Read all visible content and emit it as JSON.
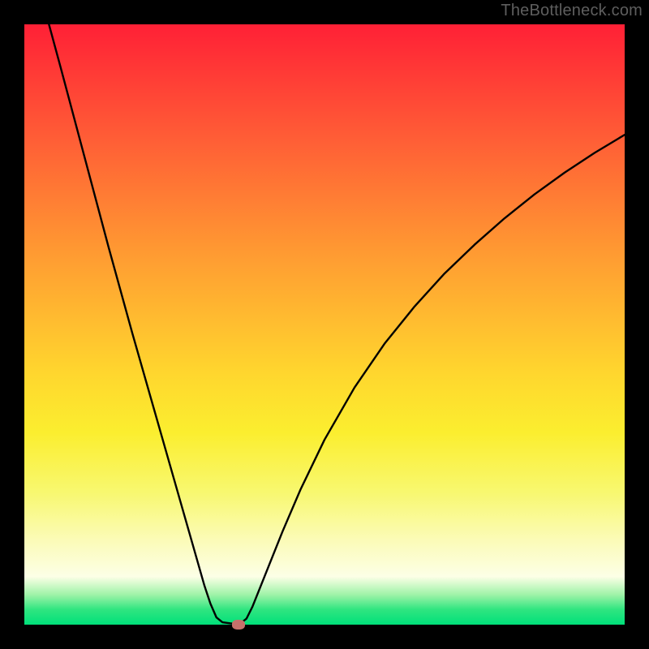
{
  "watermark": "TheBottleneck.com",
  "chart_data": {
    "type": "line",
    "title": "",
    "xlabel": "",
    "ylabel": "",
    "xlim": [
      0,
      100
    ],
    "ylim": [
      0,
      100
    ],
    "grid": false,
    "legend": false,
    "annotations": [],
    "curve_points": [
      {
        "x": 4.1,
        "y": 100.0
      },
      {
        "x": 6.0,
        "y": 93.0
      },
      {
        "x": 10.0,
        "y": 78.0
      },
      {
        "x": 14.0,
        "y": 63.0
      },
      {
        "x": 18.0,
        "y": 48.5
      },
      {
        "x": 22.0,
        "y": 34.5
      },
      {
        "x": 26.0,
        "y": 20.5
      },
      {
        "x": 28.0,
        "y": 13.5
      },
      {
        "x": 30.0,
        "y": 6.5
      },
      {
        "x": 31.0,
        "y": 3.5
      },
      {
        "x": 32.0,
        "y": 1.2
      },
      {
        "x": 33.0,
        "y": 0.4
      },
      {
        "x": 34.5,
        "y": 0.2
      },
      {
        "x": 36.0,
        "y": 0.2
      },
      {
        "x": 37.0,
        "y": 1.0
      },
      {
        "x": 38.0,
        "y": 3.0
      },
      {
        "x": 40.0,
        "y": 8.0
      },
      {
        "x": 43.0,
        "y": 15.5
      },
      {
        "x": 46.0,
        "y": 22.5
      },
      {
        "x": 50.0,
        "y": 30.8
      },
      {
        "x": 55.0,
        "y": 39.5
      },
      {
        "x": 60.0,
        "y": 46.8
      },
      {
        "x": 65.0,
        "y": 53.0
      },
      {
        "x": 70.0,
        "y": 58.5
      },
      {
        "x": 75.0,
        "y": 63.3
      },
      {
        "x": 80.0,
        "y": 67.7
      },
      {
        "x": 85.0,
        "y": 71.7
      },
      {
        "x": 90.0,
        "y": 75.3
      },
      {
        "x": 95.0,
        "y": 78.6
      },
      {
        "x": 100.0,
        "y": 81.6
      }
    ],
    "marker": {
      "x": 35.7,
      "y": 0.0
    },
    "gradient_stops": [
      {
        "pos": 0,
        "color": "#ff2036"
      },
      {
        "pos": 8,
        "color": "#ff3a36"
      },
      {
        "pos": 18,
        "color": "#ff5a36"
      },
      {
        "pos": 28,
        "color": "#ff7a34"
      },
      {
        "pos": 38,
        "color": "#ff9a32"
      },
      {
        "pos": 48,
        "color": "#ffb830"
      },
      {
        "pos": 58,
        "color": "#ffd62e"
      },
      {
        "pos": 68,
        "color": "#fbee2f"
      },
      {
        "pos": 78,
        "color": "#f8f870"
      },
      {
        "pos": 86,
        "color": "#fbfbb8"
      },
      {
        "pos": 92,
        "color": "#fcffe6"
      },
      {
        "pos": 95,
        "color": "#9ff3a8"
      },
      {
        "pos": 97.5,
        "color": "#2fe580"
      },
      {
        "pos": 100,
        "color": "#00e07a"
      }
    ]
  }
}
